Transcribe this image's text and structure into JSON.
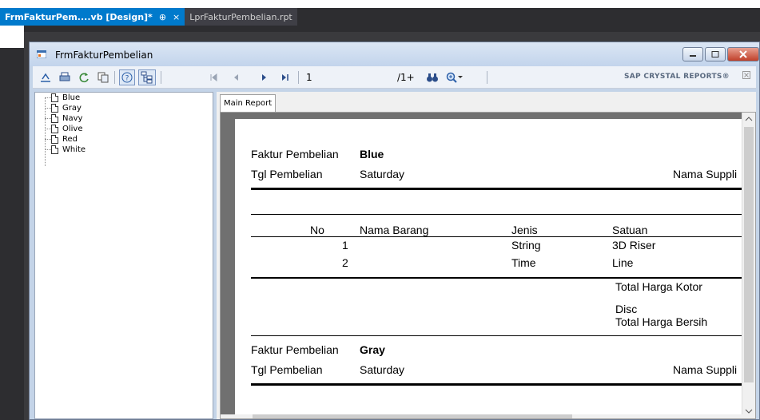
{
  "ide": {
    "tabs": [
      {
        "label": "FrmFakturPem....vb [Design]*",
        "pin": "⊕",
        "close": "×"
      },
      {
        "label": "LprFakturPembelian.rpt"
      }
    ]
  },
  "window": {
    "title": "FrmFakturPembelian"
  },
  "toolbar": {
    "page_value": "1",
    "page_total": "/1+",
    "brand": "SAP CRYSTAL REPORTS®"
  },
  "tree": {
    "items": [
      {
        "label": "Blue"
      },
      {
        "label": "Gray"
      },
      {
        "label": "Navy"
      },
      {
        "label": "Olive"
      },
      {
        "label": "Red"
      },
      {
        "label": "White"
      }
    ]
  },
  "viewer": {
    "main_tab": "Main Report"
  },
  "report": {
    "labels": {
      "faktur": "Faktur Pembelian",
      "tgl": "Tgl Pembelian",
      "supplier": "Nama Suppli",
      "col_no": "No",
      "col_nama": "Nama Barang",
      "col_jenis": "Jenis",
      "col_satuan": "Satuan",
      "total_kotor": "Total Harga Kotor",
      "disc": "Disc",
      "total_bersih": "Total Harga Bersih"
    },
    "groups": [
      {
        "name": "Blue",
        "date": "Saturday",
        "rows": [
          {
            "no": "1",
            "nama": "",
            "jenis": "String",
            "satuan": "3D Riser"
          },
          {
            "no": "2",
            "nama": "",
            "jenis": "Time",
            "satuan": "Line"
          }
        ]
      },
      {
        "name": "Gray",
        "date": "Saturday"
      }
    ]
  }
}
